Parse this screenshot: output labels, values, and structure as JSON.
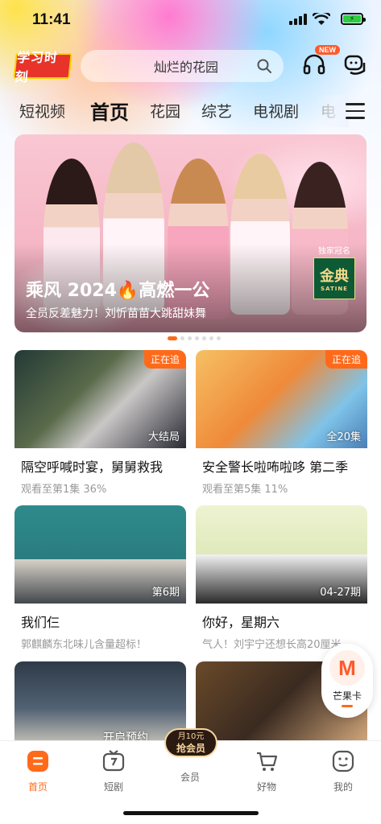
{
  "status_bar": {
    "time": "11:41"
  },
  "header": {
    "logo_text": "学习时刻",
    "search_placeholder": "灿烂的花园",
    "new_badge": "NEW"
  },
  "tabs": [
    {
      "label": "短视频"
    },
    {
      "label": "首页",
      "active": true
    },
    {
      "label": "花园"
    },
    {
      "label": "综艺"
    },
    {
      "label": "电视剧"
    },
    {
      "label": "电"
    }
  ],
  "banner": {
    "title": "乘风 2024🔥高燃一公",
    "subtitle": "全员反差魅力！刘忻苗苗大跳甜妹舞",
    "sponsor_label": "独家冠名",
    "sponsor_brand": "金典",
    "sponsor_brand_en": "SATINE"
  },
  "cards": [
    {
      "title": "隔空呼喊时宴，舅舅救我",
      "sub": "观看至第1集 36%",
      "badge": "正在追",
      "ep": "大结局",
      "color": "#3a2a2f"
    },
    {
      "title": "安全警长啦咘啦哆 第二季",
      "sub": "观看至第5集 11%",
      "badge": "正在追",
      "ep": "全20集",
      "color": "#e9a64c"
    },
    {
      "title": "我们仨",
      "sub": "郭麒麟东北味儿含量超标！",
      "ep": "第6期",
      "color": "#2f8a8b"
    },
    {
      "title": "你好，星期六",
      "sub": "气人！刘宇宁还想长高20厘米",
      "ep": "04-27期",
      "color": "#e7f0c8"
    },
    {
      "title": "",
      "sub": "",
      "ep": "",
      "color": "#3b4654"
    },
    {
      "title": "",
      "sub": "",
      "ep": "",
      "color": "#3a2c22"
    }
  ],
  "card5_overlay": "开启预约",
  "floating": {
    "label": "芒果卡",
    "letter": "M"
  },
  "nav": {
    "items": [
      {
        "label": "首页",
        "active": true
      },
      {
        "label": "短剧"
      },
      {
        "label": "会员"
      },
      {
        "label": "好物"
      },
      {
        "label": "我的"
      }
    ],
    "vip_top": "月10元",
    "vip_bottom": "抢会员"
  },
  "colors": {
    "accent": "#ff6a1a"
  }
}
